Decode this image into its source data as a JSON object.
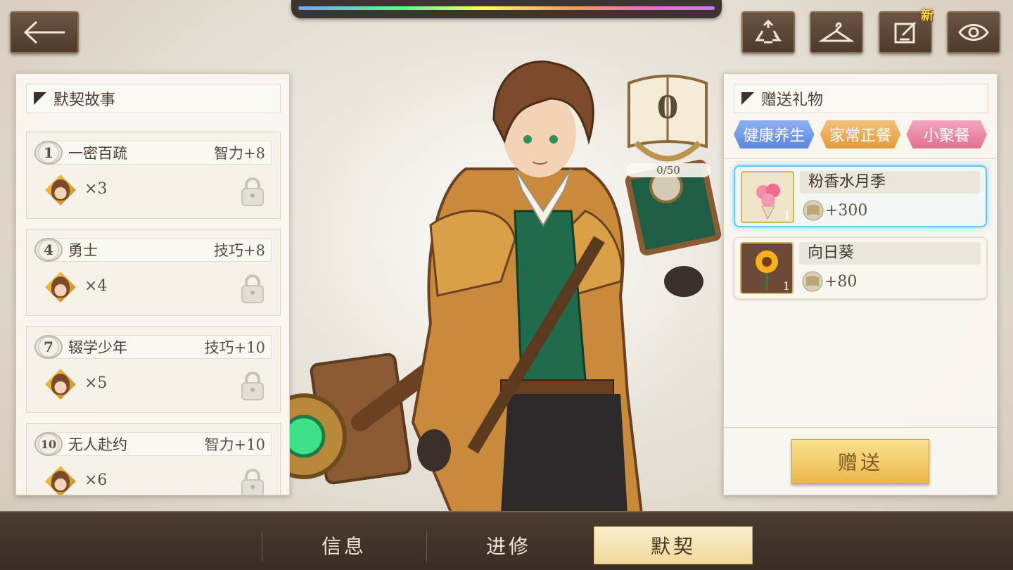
{
  "top_buttons": {
    "back": "back-arrow-icon",
    "recycle": "recycle-icon",
    "hanger": "hanger-icon",
    "edit": "edit-icon",
    "edit_badge": "新",
    "eye": "eye-icon"
  },
  "story_panel": {
    "title": "默契故事",
    "stories": [
      {
        "num": "1",
        "title": "一密百疏",
        "reward": "智力+8",
        "count": "×3"
      },
      {
        "num": "4",
        "title": "勇士",
        "reward": "技巧+8",
        "count": "×4"
      },
      {
        "num": "7",
        "title": "辍学少年",
        "reward": "技巧+10",
        "count": "×5"
      },
      {
        "num": "10",
        "title": "无人赴约",
        "reward": "智力+10",
        "count": "×6"
      }
    ]
  },
  "counter": {
    "value": "0",
    "progress": "0/50"
  },
  "gift_panel": {
    "title": "赠送礼物",
    "tabs": [
      "健康养生",
      "家常正餐",
      "小聚餐"
    ],
    "gifts": [
      {
        "name": "粉香水月季",
        "bonus": "+300",
        "qty": "1",
        "selected": true
      },
      {
        "name": "向日葵",
        "bonus": "+80",
        "qty": "1",
        "selected": false
      }
    ],
    "give_label": "赠送"
  },
  "bottom_nav": {
    "items": [
      "信息",
      "进修",
      "默契"
    ],
    "active": "默契"
  },
  "colors": {
    "accent_gold": "#e9b748",
    "selection_blue": "#5fc8f4",
    "nav_bg": "#3a2d24"
  }
}
